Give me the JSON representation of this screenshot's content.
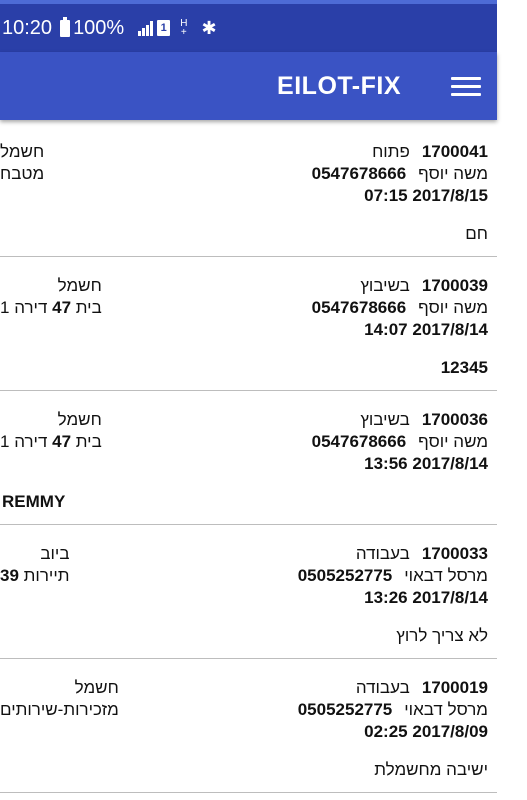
{
  "status_bar": {
    "time": "10:20",
    "battery": "100%",
    "network": "H",
    "network_sub": "+",
    "sim": "1"
  },
  "app_bar": {
    "title": "EILOT-FIX",
    "menu_icon": "hamburger-menu-icon"
  },
  "tickets": [
    {
      "id": "1700041",
      "status": "פתוח",
      "name": "משה יוסף",
      "phone": "0547678666",
      "datetime": "2017/8/15 07:15",
      "category": "חשמל",
      "location": "מטבח",
      "note": "חם",
      "note_align": "right"
    },
    {
      "id": "1700039",
      "status": "בשיבוץ",
      "name": "משה יוסף",
      "phone": "0547678666",
      "datetime": "2017/8/14 14:07",
      "category": "חשמל",
      "location_a": "בית",
      "location_num": "47",
      "location_b": "דירה 1",
      "note": "12345",
      "note_align": "right"
    },
    {
      "id": "1700036",
      "status": "בשיבוץ",
      "name": "משה יוסף",
      "phone": "0547678666",
      "datetime": "2017/8/14 13:56",
      "category": "חשמל",
      "location_a": "בית",
      "location_num": "47",
      "location_b": "דירה 1",
      "note": "REMMY",
      "note_align": "left"
    },
    {
      "id": "1700033",
      "status": "בעבודה",
      "name": "מרסל דבאוי",
      "phone": "0505252775",
      "datetime": "2017/8/14 13:26",
      "category": "ביוב",
      "location_a": "תיירות",
      "location_num": "39",
      "note": "לא צריך לרוץ",
      "note_align": "right"
    },
    {
      "id": "1700019",
      "status": "בעבודה",
      "name": "מרסל דבאוי",
      "phone": "0505252775",
      "datetime": "2017/8/09 02:25",
      "category": "חשמל",
      "location": "מזכירות-שירותים",
      "note": "ישיבה מחשמלת",
      "note_align": "right"
    }
  ]
}
